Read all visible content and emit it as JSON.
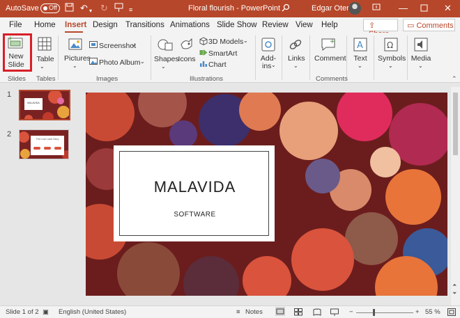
{
  "titlebar": {
    "autosave_label": "AutoSave",
    "autosave_state": "Off",
    "doc_title": "Floral flourish - PowerPoint",
    "user_name": "Edgar Otero",
    "accent": "#b7472a"
  },
  "tabs": {
    "file": "File",
    "home": "Home",
    "insert": "Insert",
    "design": "Design",
    "transitions": "Transitions",
    "animations": "Animations",
    "slideshow": "Slide Show",
    "review": "Review",
    "view": "View",
    "help": "Help",
    "share": "Share",
    "comments": "Comments"
  },
  "ribbon": {
    "new_slide": "New",
    "new_slide2": "Slide",
    "table": "Table",
    "pictures": "Pictures",
    "screenshot": "Screenshot",
    "photo_album": "Photo Album",
    "shapes": "Shapes",
    "icons": "Icons",
    "models3d": "3D Models",
    "smartart": "SmartArt",
    "chart": "Chart",
    "addins": "Add-",
    "addins2": "ins",
    "links": "Links",
    "comment": "Comment",
    "text": "Text",
    "symbols": "Symbols",
    "media": "Media",
    "groups": {
      "slides": "Slides",
      "tables": "Tables",
      "images": "Images",
      "illustrations": "Illustrations",
      "comments": "Comments"
    }
  },
  "thumbnails": {
    "num1": "1",
    "num2": "2",
    "thumb1_text": "MALAVIDA",
    "thumb2_text": "The Love Laws Story"
  },
  "slide": {
    "title": "MALAVIDA",
    "subtitle": "SOFTWARE"
  },
  "status": {
    "slide_info": "Slide 1 of 2",
    "language": "English (United States)",
    "notes": "Notes",
    "zoom": "55 %"
  }
}
